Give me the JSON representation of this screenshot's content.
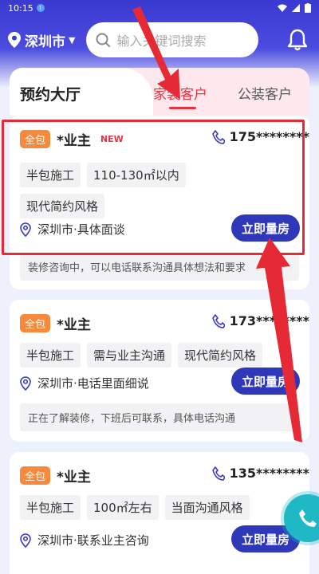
{
  "status_bar": {
    "time": "10:15",
    "notif": "!"
  },
  "header": {
    "city": "深圳市",
    "search_placeholder": "输入关键词搜索"
  },
  "tabs": {
    "title": "预约大厅",
    "home": "家装客户",
    "public": "公装客户"
  },
  "cards": [
    {
      "badge": "全包",
      "owner": "*业主",
      "new": "NEW",
      "phone": "175********",
      "tags": [
        "半包施工",
        "110-130㎡以内",
        "现代简约风格"
      ],
      "location": "深圳市·具体面谈",
      "button": "立即量房",
      "desc": "装修咨询中，可以电话联系沟通具体想法和要求"
    },
    {
      "badge": "全包",
      "owner": "*业主",
      "new": "",
      "phone": "173********",
      "tags": [
        "半包施工",
        "需与业主沟通",
        "现代简约风格"
      ],
      "location": "深圳市·电话里面细说",
      "button": "立即量房",
      "desc": "正在了解装修，下班后可联系，具体电话沟通"
    },
    {
      "badge": "全包",
      "owner": "*业主",
      "new": "",
      "phone": "135********",
      "tags": [
        "半包施工",
        "100㎡左右",
        "当面沟通风格"
      ],
      "location": "深圳市·联系业主咨询",
      "button": "立即量房",
      "desc": ""
    }
  ],
  "colors": {
    "brand": "#2f38b8",
    "accent": "#e8333f",
    "badge": "#f6893b",
    "annotation": "#e52a36"
  }
}
